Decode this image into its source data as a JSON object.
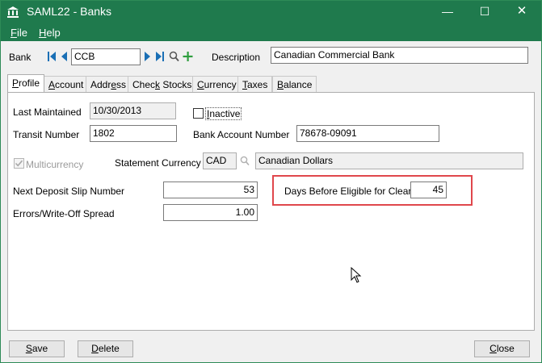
{
  "window": {
    "title": "SAML22 - Banks",
    "controls": {
      "minimize": "—",
      "maximize": "☐",
      "close": "✕"
    }
  },
  "menu": [
    {
      "label_pre": "",
      "mnemonic": "F",
      "label_post": "ile"
    },
    {
      "label_pre": "",
      "mnemonic": "H",
      "label_post": "elp"
    }
  ],
  "header": {
    "bank_label": "Bank",
    "bank_code": "CCB",
    "description_label": "Description",
    "description_value": "Canadian Commercial Bank"
  },
  "tabs": [
    {
      "pre": "",
      "mnemonic": "P",
      "post": "rofile"
    },
    {
      "pre": "",
      "mnemonic": "A",
      "post": "ccount"
    },
    {
      "pre": "Addr",
      "mnemonic": "e",
      "post": "ss"
    },
    {
      "pre": "Chec",
      "mnemonic": "k",
      "post": " Stocks"
    },
    {
      "pre": "",
      "mnemonic": "C",
      "post": "urrency"
    },
    {
      "pre": "",
      "mnemonic": "T",
      "post": "axes"
    },
    {
      "pre": "",
      "mnemonic": "B",
      "post": "alance"
    }
  ],
  "profile": {
    "last_maintained_label": "Last Maintained",
    "last_maintained_value": "10/30/2013",
    "inactive_pre": "",
    "inactive_mnemonic": "I",
    "inactive_post": "nactive",
    "inactive_checked": false,
    "transit_number_label": "Transit Number",
    "transit_number_value": "1802",
    "bank_account_number_label": "Bank Account Number",
    "bank_account_number_value": "78678-09091",
    "multicurrency_label": "Multicurrency",
    "multicurrency_checked": true,
    "statement_currency_label": "Statement Currency",
    "statement_currency_code": "CAD",
    "statement_currency_name": "Canadian Dollars",
    "next_deposit_slip_label": "Next Deposit Slip Number",
    "next_deposit_slip_value": "53",
    "days_before_clearing_label": "Days Before Eligible for Clearing",
    "days_before_clearing_value": "45",
    "errors_writeoff_label": "Errors/Write-Off Spread",
    "errors_writeoff_value": "1.00"
  },
  "buttons": {
    "save": {
      "mnemonic": "S",
      "post": "ave"
    },
    "delete": {
      "mnemonic": "D",
      "post": "elete"
    },
    "close": {
      "mnemonic": "C",
      "post": "lose"
    }
  },
  "colors": {
    "titlebar": "#1f7a4d",
    "accent_highlight": "#e0474c",
    "nav_arrow": "#1a6fb5",
    "add_icon": "#2e9e3e"
  }
}
